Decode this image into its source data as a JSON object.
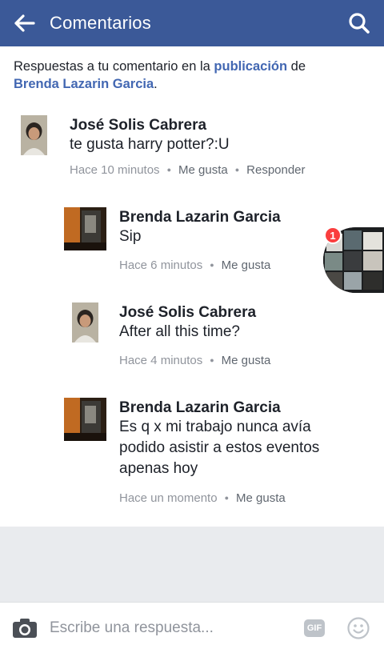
{
  "header": {
    "title": "Comentarios"
  },
  "intro": {
    "prefix": "Respuestas a tu comentario en la ",
    "link_publicacion": "publicación",
    "middle": " de",
    "link_author": "Brenda Lazarin Garcia",
    "suffix": "."
  },
  "comments": [
    {
      "author": "José Solis Cabrera",
      "text": "te gusta harry potter?:U",
      "time": "Hace 10 minutos",
      "like": "Me gusta",
      "reply": "Responder"
    },
    {
      "author": "Brenda Lazarin Garcia",
      "text": "Sip",
      "time": "Hace 6 minutos",
      "like": "Me gusta"
    },
    {
      "author": "José Solis Cabrera",
      "text": "After all this time?",
      "time": "Hace 4 minutos",
      "like": "Me gusta"
    },
    {
      "author": "Brenda Lazarin Garcia",
      "text": "Es q x mi trabajo nunca avía podido asistir a estos eventos apenas hoy",
      "time": "Hace un momento",
      "like": "Me gusta"
    }
  ],
  "chat_head": {
    "badge_count": "1"
  },
  "composer": {
    "placeholder": "Escribe una respuesta...",
    "gif_label": "GIF"
  },
  "icons": {
    "back": "arrow-left-icon",
    "search": "search-icon",
    "camera": "camera-icon",
    "emoji": "smiley-icon"
  },
  "colors": {
    "brand": "#3b5998",
    "link": "#4267b2",
    "meta": "#90949c",
    "badge": "#fa3e3e"
  }
}
